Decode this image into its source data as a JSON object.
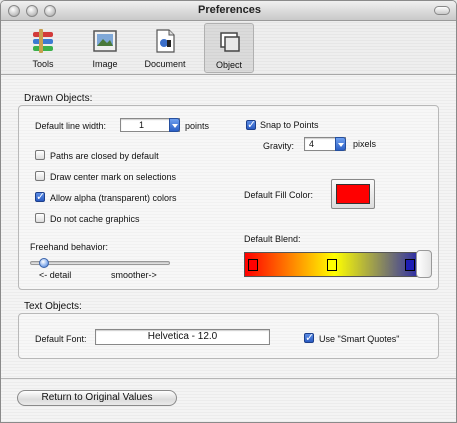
{
  "window": {
    "title": "Preferences"
  },
  "toolbar": {
    "items": [
      {
        "label": "Tools",
        "icon": "tools-icon"
      },
      {
        "label": "Image",
        "icon": "image-icon"
      },
      {
        "label": "Document",
        "icon": "document-icon"
      },
      {
        "label": "Object",
        "icon": "object-icon",
        "selected": true
      }
    ]
  },
  "drawn": {
    "title": "Drawn Objects:",
    "line_width_label": "Default line width:",
    "line_width_value": "1",
    "line_width_unit": "points",
    "snap_label": "Snap to Points",
    "snap_checked": true,
    "gravity_label": "Gravity:",
    "gravity_value": "4",
    "gravity_unit": "pixels",
    "checkboxes": [
      {
        "label": "Paths are closed by default",
        "checked": false
      },
      {
        "label": "Draw center mark on selections",
        "checked": false
      },
      {
        "label": "Allow alpha (transparent) colors",
        "checked": true
      },
      {
        "label": "Do not cache graphics",
        "checked": false
      }
    ],
    "fill_label": "Default Fill Color:",
    "fill_color": "#ff0000",
    "freehand_label": "Freehand behavior:",
    "freehand_left": "<- detail",
    "freehand_right": "smoother->",
    "freehand_level": 0.1,
    "blend_label": "Default Blend:",
    "blend_colors": [
      "#ff0000",
      "#ffff00",
      "#1e1eb4"
    ]
  },
  "text": {
    "title": "Text Objects:",
    "font_label": "Default Font:",
    "font_value": "Helvetica - 12.0",
    "smart_quotes_label": "Use \"Smart Quotes\"",
    "smart_quotes_checked": true
  },
  "footer": {
    "reset_label": "Return to Original Values"
  }
}
